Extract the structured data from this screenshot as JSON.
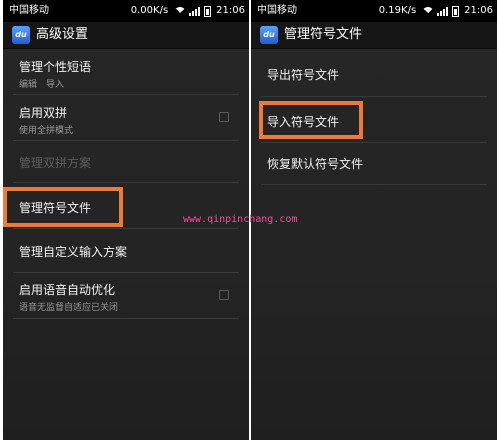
{
  "left_screen": {
    "status_bar": {
      "carrier": "中国移动",
      "speed": "0.00K/s",
      "time": "21:06"
    },
    "action_bar": {
      "app_icon_text": "du",
      "title": "高级设置"
    },
    "items": [
      {
        "label": "管理个性短语",
        "sub": "编辑　导入"
      },
      {
        "label": "启用双拼",
        "sub": "使用全拼模式"
      },
      {
        "label": "管理双拼方案"
      },
      {
        "label": "管理符号文件"
      },
      {
        "label": "管理自定义输入方案"
      },
      {
        "label": "启用语音自动优化",
        "sub": "语音无监督自适应已关闭"
      }
    ]
  },
  "right_screen": {
    "status_bar": {
      "carrier": "中国移动",
      "speed": "0.19K/s",
      "time": "21:06"
    },
    "action_bar": {
      "app_icon_text": "du",
      "title": "管理符号文件"
    },
    "items": [
      {
        "label": "导出符号文件"
      },
      {
        "label": "导入符号文件"
      },
      {
        "label": "恢复默认符号文件"
      }
    ]
  },
  "watermark": "www.qinpinchang.com",
  "colors": {
    "highlight": "#ee7a3a",
    "watermark": "#ff4aa0",
    "screen_bg": "#242424",
    "disabled_text": "#5e5e5e"
  }
}
